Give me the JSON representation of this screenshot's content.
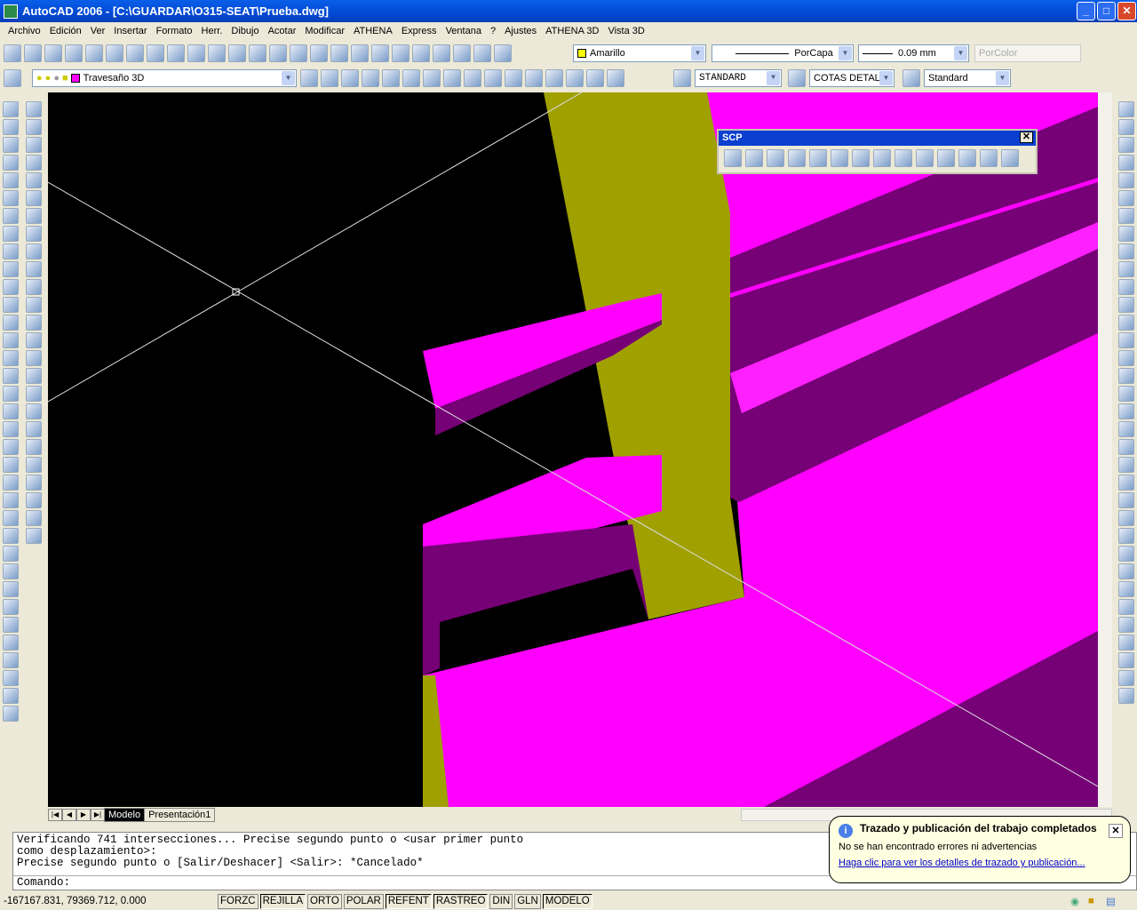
{
  "window": {
    "title": "AutoCAD 2006 - [C:\\GUARDAR\\O315-SEAT\\Prueba.dwg]",
    "minimize": "_",
    "maximize": "□",
    "close": "✕"
  },
  "menu": [
    "Archivo",
    "Edición",
    "Ver",
    "Insertar",
    "Formato",
    "Herr.",
    "Dibujo",
    "Acotar",
    "Modificar",
    "ATHENA",
    "Express",
    "Ventana",
    "?",
    "Ajustes",
    "ATHENA 3D",
    "Vista 3D"
  ],
  "properties": {
    "color": "Amarillo",
    "color_hex": "#ffff00",
    "linetype": "PorCapa",
    "lineweight": "0.09 mm",
    "plotstyle": "PorColor"
  },
  "layer": {
    "name": "Travesaño 3D",
    "color_hex": "#ff00ff"
  },
  "styles": {
    "text_style": "STANDARD",
    "dim_style": "COTAS DETAL",
    "table_style": "Standard"
  },
  "scp_toolbar": {
    "title": "SCP",
    "close": "✕"
  },
  "layout_tabs": [
    "Modelo",
    "Presentación1"
  ],
  "command": {
    "lines": [
      "Verificando 741 intersecciones... Precise segundo punto o <usar primer punto",
      "como desplazamiento>:",
      "Precise segundo punto o [Salir/Deshacer] <Salir>: *Cancelado*"
    ],
    "prompt": "Comando:"
  },
  "status": {
    "coords": "-167167.831, 79369.712, 0.000",
    "buttons": [
      {
        "label": "FORZC",
        "on": false
      },
      {
        "label": "REJILLA",
        "on": true
      },
      {
        "label": "ORTO",
        "on": false
      },
      {
        "label": "POLAR",
        "on": false
      },
      {
        "label": "REFENT",
        "on": true
      },
      {
        "label": "RASTREO",
        "on": true
      },
      {
        "label": "DIN",
        "on": false
      },
      {
        "label": "GLN",
        "on": false
      },
      {
        "label": "MODELO",
        "on": true
      }
    ]
  },
  "notification": {
    "title": "Trazado y publicación del trabajo completados",
    "message": "No se han encontrado errores ni advertencias",
    "link": "Haga clic para ver los detalles de trazado y publicación...",
    "close": "✕"
  },
  "colors": {
    "magenta": "#ff00ff",
    "purple": "#760076",
    "olive": "#a0a000",
    "background": "#000000"
  }
}
